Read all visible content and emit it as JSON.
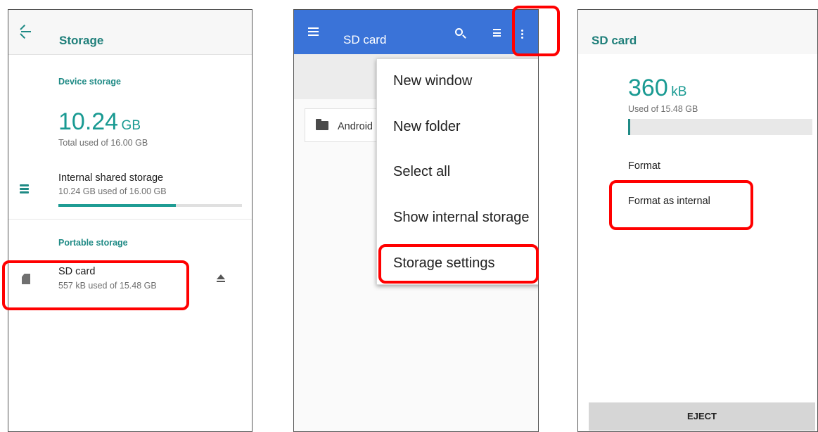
{
  "settings_screen": {
    "title": "Storage",
    "device_storage": {
      "header": "Device storage",
      "used_value": "10.24",
      "used_unit": "GB",
      "used_caption": "Total used of 16.00 GB",
      "internal": {
        "title": "Internal shared storage",
        "subtitle": "10.24 GB used of 16.00 GB",
        "fraction_used": 0.64
      }
    },
    "portable_storage": {
      "header": "Portable storage",
      "sd_card": {
        "title": "SD card",
        "subtitle": "557 kB used of 15.48 GB"
      }
    }
  },
  "files_screen": {
    "title": "SD card",
    "folder": "Android",
    "menu": [
      "New window",
      "New folder",
      "Select all",
      "Show internal storage",
      "Storage settings"
    ]
  },
  "sd_detail_screen": {
    "title": "SD card",
    "used_value": "360",
    "used_unit": "kB",
    "used_caption": "Used of 15.48 GB",
    "options": [
      "Format",
      "Format as internal"
    ],
    "eject_label": "EJECT"
  },
  "colors": {
    "accent": "#1f8a85",
    "files_toolbar": "#3a73d8",
    "highlight": "#ff0000"
  }
}
